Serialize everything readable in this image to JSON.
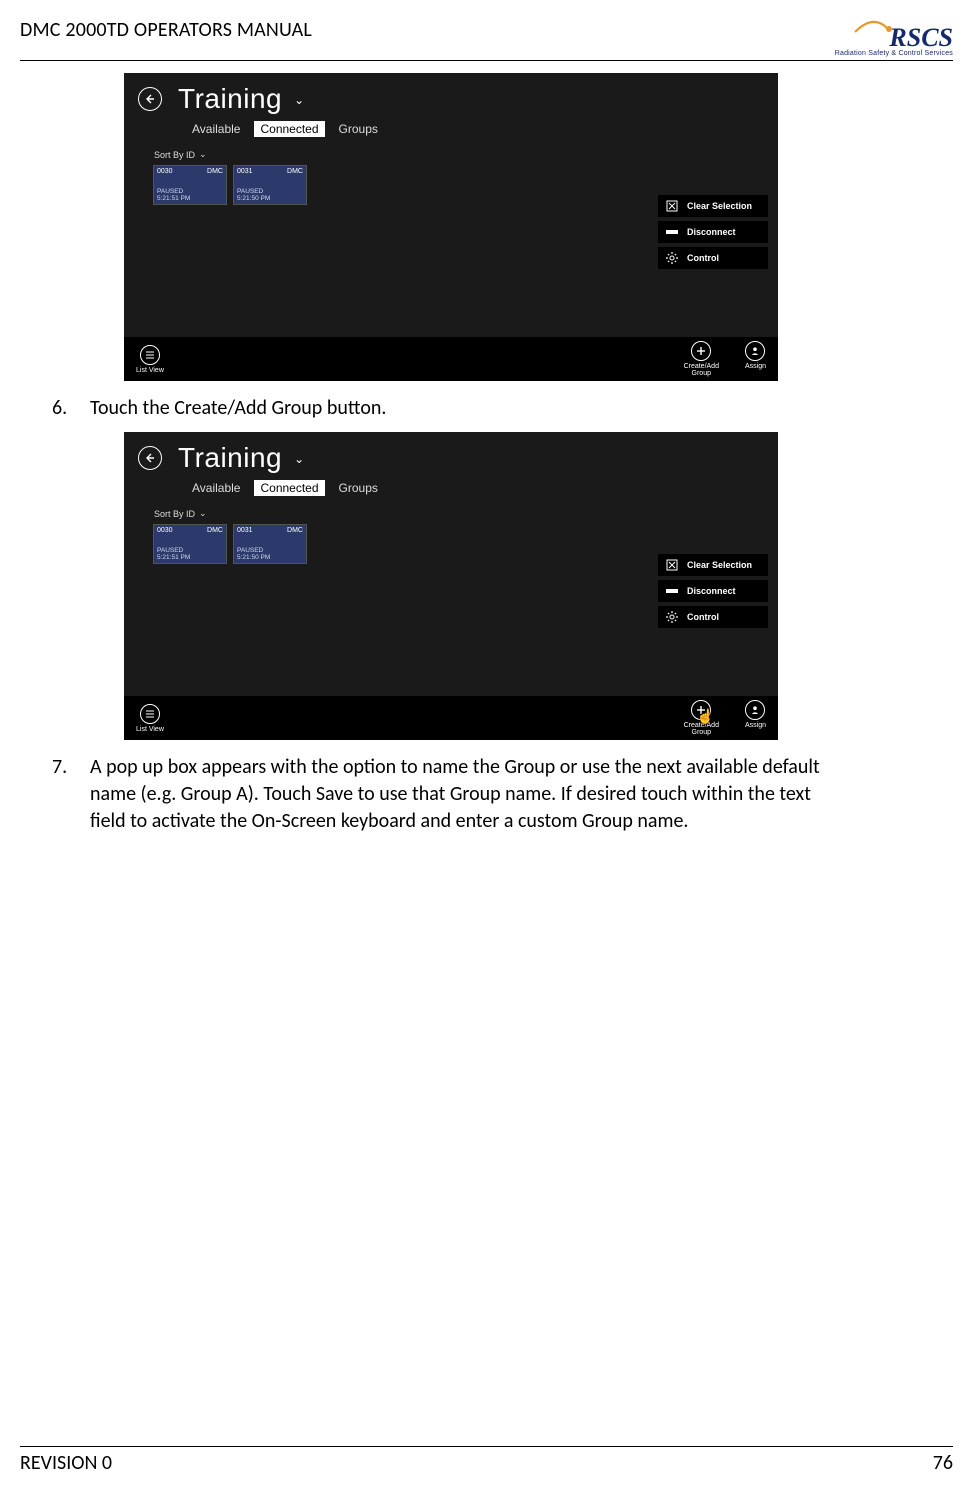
{
  "doc": {
    "title": "DMC 2000TD OPERATORS MANUAL",
    "revision": "REVISION 0",
    "page_number": "76",
    "logo_text": "RSCS",
    "logo_sub": "Radiation Safety & Control Services"
  },
  "steps": {
    "six": {
      "num": "6.",
      "text": "Touch the Create/Add Group button."
    },
    "seven": {
      "num": "7.",
      "text": "A pop up box appears with the option to name the Group or use the next available default name (e.g. Group A). Touch Save to use that Group name. If desired touch within the text field to activate the On-Screen keyboard and enter a custom Group name."
    }
  },
  "screenshot": {
    "title": "Training",
    "tabs": {
      "available": "Available",
      "connected": "Connected",
      "groups": "Groups"
    },
    "sort_label": "Sort By ID",
    "devices": [
      {
        "id": "0030",
        "tag": "DMC",
        "status": "PAUSED",
        "time": "5:21:51 PM"
      },
      {
        "id": "0031",
        "tag": "DMC",
        "status": "PAUSED",
        "time": "5:21:50 PM"
      }
    ],
    "actions": {
      "clear": "Clear Selection",
      "disconnect": "Disconnect",
      "control": "Control"
    },
    "bottom": {
      "listview": "List View",
      "createadd": "Create/Add\nGroup",
      "assign": "Assign"
    }
  }
}
